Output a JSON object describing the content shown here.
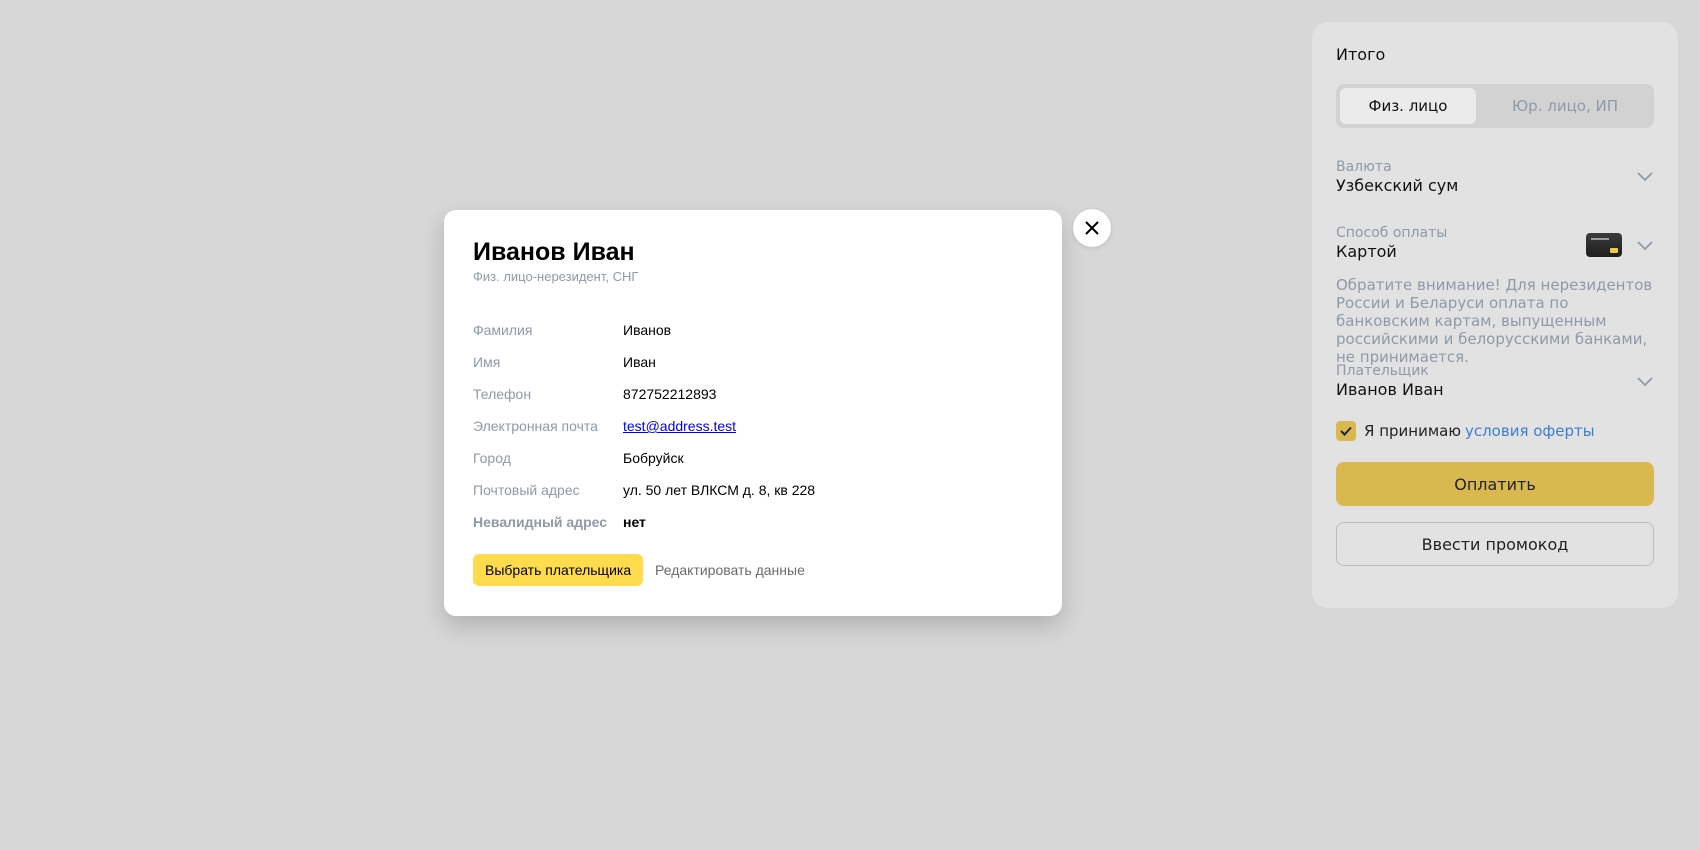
{
  "summary": {
    "title": "Итого",
    "tabs": [
      {
        "label": "Физ. лицо",
        "active": true
      },
      {
        "label": "Юр. лицо, ИП",
        "active": false
      }
    ],
    "currency": {
      "label": "Валюта",
      "value": "Узбекский сум"
    },
    "payment_method": {
      "label": "Способ оплаты",
      "value": "Картой",
      "icon": "bank-card-icon"
    },
    "notice": "Обратите внимание! Для нерезидентов России и Беларуси оплата по банковским картам, выпущенным российскими и белорусскими банками, не принимается.",
    "payer": {
      "label": "Плательщик",
      "value": "Иванов Иван"
    },
    "accept": {
      "text": "Я принимаю",
      "link": "условия оферты",
      "checked": true
    },
    "pay_label": "Оплатить",
    "promo_label": "Ввести промокод"
  },
  "modal": {
    "title": "Иванов Иван",
    "subtitle": "Физ. лицо-нерезидент, СНГ",
    "rows": [
      {
        "label": "Фамилия",
        "value": "Иванов"
      },
      {
        "label": "Имя",
        "value": "Иван"
      },
      {
        "label": "Телефон",
        "value": "872752212893"
      },
      {
        "label": "Электронная почта",
        "value": "test@address.test"
      },
      {
        "label": "Город",
        "value": "Бобруйск"
      },
      {
        "label": "Почтовый адрес",
        "value": "ул. 50 лет ВЛКСМ д. 8, кв 228"
      },
      {
        "label": "Невалидный адрес",
        "value": "нет"
      }
    ],
    "choose_label": "Выбрать плательщика",
    "edit_label": "Редактировать данные"
  },
  "colors": {
    "accent": "#ffdb4d",
    "pay_button": "#d9b850",
    "link": "#3a7fd5",
    "muted": "#8e9aa8"
  }
}
